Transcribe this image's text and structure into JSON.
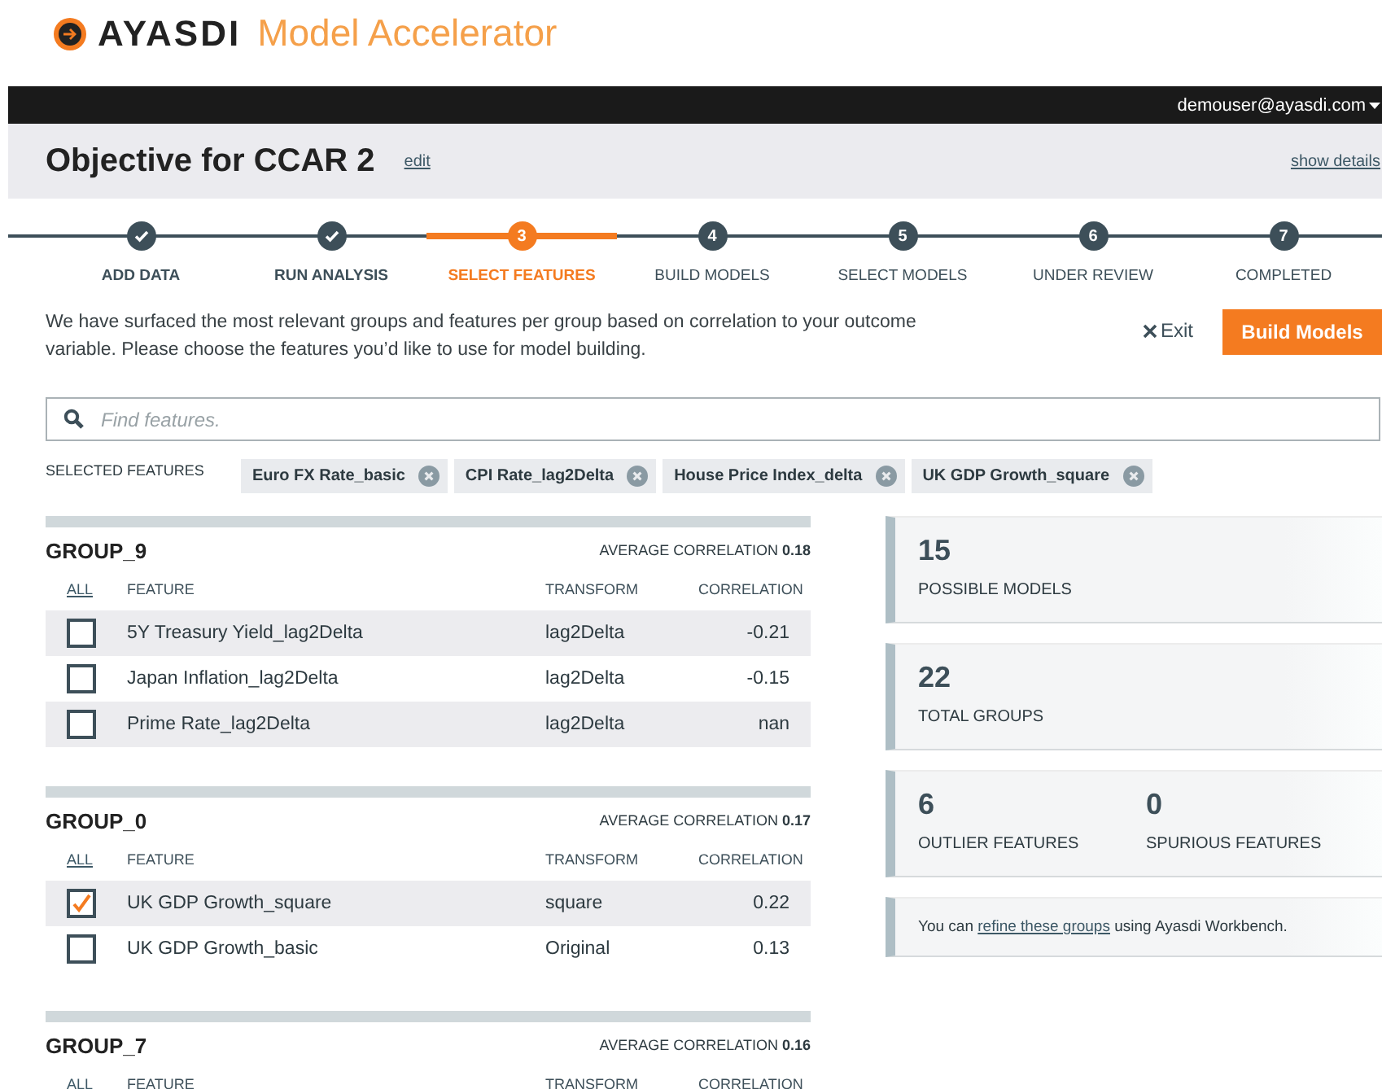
{
  "brand": {
    "name": "AYASDI",
    "product": "Model Accelerator"
  },
  "user_menu": {
    "label": "demouser@ayasdi.com"
  },
  "objective": {
    "title": "Objective for CCAR 2",
    "edit_link": "edit",
    "details_link": "show details"
  },
  "steps": [
    {
      "label": "ADD DATA",
      "done": true,
      "selected": false
    },
    {
      "label": "RUN ANALYSIS",
      "done": true,
      "selected": false
    },
    {
      "number": "3",
      "label": "SELECT FEATURES",
      "done": false,
      "selected": true
    },
    {
      "number": "4",
      "label": "BUILD MODELS",
      "done": false,
      "selected": false
    },
    {
      "number": "5",
      "label": "SELECT MODELS",
      "done": false,
      "selected": false
    },
    {
      "number": "6",
      "label": "UNDER REVIEW",
      "done": false,
      "selected": false
    },
    {
      "number": "7",
      "label": "COMPLETED",
      "done": false,
      "selected": false
    }
  ],
  "intro": "We have surfaced the most relevant groups and features per group based on correlation to your outcome variable. Please choose the features you’d like to use for model building.",
  "exit_button": "Exit",
  "build_button": "Build Models",
  "search": {
    "placeholder": "Find features."
  },
  "selected_features": {
    "label": "SELECTED FEATURES",
    "tags": [
      "Euro FX Rate_basic",
      "CPI Rate_lag2Delta",
      "House Price Index_delta",
      "UK GDP Growth_square"
    ]
  },
  "groups": [
    {
      "name": "GROUP_9",
      "avg_label": "AVERAGE CORRELATION",
      "avg_value": "0.18",
      "columns": [
        "ALL",
        "FEATURE",
        "TRANSFORM",
        "CORRELATION"
      ],
      "rows": [
        {
          "feature": "5Y Treasury Yield_lag2Delta",
          "transform": "lag2Delta",
          "correlation": "-0.21",
          "checked": false
        },
        {
          "feature": "Japan Inflation_lag2Delta",
          "transform": "lag2Delta",
          "correlation": "-0.15",
          "checked": false
        },
        {
          "feature": "Prime Rate_lag2Delta",
          "transform": "lag2Delta",
          "correlation": "nan",
          "checked": false
        }
      ]
    },
    {
      "name": "GROUP_0",
      "avg_label": "AVERAGE CORRELATION",
      "avg_value": "0.17",
      "columns": [
        "ALL",
        "FEATURE",
        "TRANSFORM",
        "CORRELATION"
      ],
      "rows": [
        {
          "feature": "UK GDP Growth_square",
          "transform": "square",
          "correlation": "0.22",
          "checked": true
        },
        {
          "feature": "UK GDP Growth_basic",
          "transform": "Original",
          "correlation": "0.13",
          "checked": false
        }
      ]
    },
    {
      "name": "GROUP_7",
      "avg_label": "AVERAGE CORRELATION",
      "avg_value": "0.16",
      "columns": [
        "ALL",
        "FEATURE",
        "TRANSFORM",
        "CORRELATION"
      ]
    }
  ],
  "stat_cards": [
    {
      "stats": [
        {
          "value": "15",
          "label": "POSSIBLE MODELS"
        }
      ]
    },
    {
      "stats": [
        {
          "value": "22",
          "label": "TOTAL GROUPS"
        }
      ]
    },
    {
      "stats": [
        {
          "value": "6",
          "label": "OUTLIER FEATURES"
        },
        {
          "value": "0",
          "label": "SPURIOUS FEATURES"
        }
      ]
    }
  ],
  "note": {
    "before": "You can",
    "link": "refine these groups",
    "after": "using Ayasdi Workbench."
  }
}
